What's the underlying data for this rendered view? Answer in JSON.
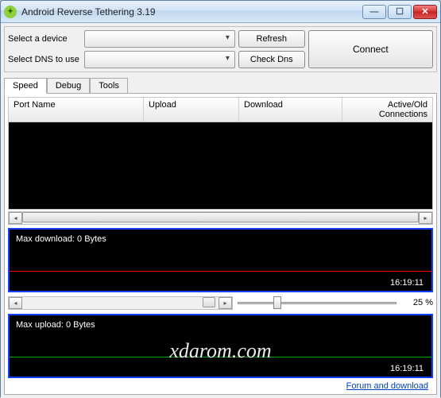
{
  "window": {
    "title": "Android Reverse Tethering 3.19"
  },
  "selectors": {
    "device_label": "Select a device",
    "dns_label": "Select DNS to use",
    "device_value": "",
    "dns_value": ""
  },
  "buttons": {
    "refresh": "Refresh",
    "check_dns": "Check Dns",
    "connect": "Connect"
  },
  "tabs": {
    "speed": "Speed",
    "debug": "Debug",
    "tools": "Tools",
    "active": "Speed"
  },
  "columns": {
    "port_name": "Port Name",
    "upload": "Upload",
    "download": "Download",
    "active_old": "Active/Old Connections"
  },
  "chart_data": [
    {
      "type": "line",
      "title": "Max download: 0 Bytes",
      "timestamp": "16:19:11",
      "series": [
        {
          "name": "download",
          "color": "#ff0000",
          "values": [
            0
          ]
        }
      ],
      "ylim": [
        0,
        0
      ],
      "xlabel": "",
      "ylabel": ""
    },
    {
      "type": "line",
      "title": "Max upload: 0 Bytes",
      "timestamp": "16:19:11",
      "series": [
        {
          "name": "upload",
          "color": "#00b000",
          "values": [
            0
          ]
        }
      ],
      "ylim": [
        0,
        0
      ],
      "xlabel": "",
      "ylabel": ""
    }
  ],
  "slider": {
    "percent_label": "25 %",
    "percent": 25
  },
  "footer": {
    "link": "Forum and download"
  },
  "watermark": "xdarom.com"
}
